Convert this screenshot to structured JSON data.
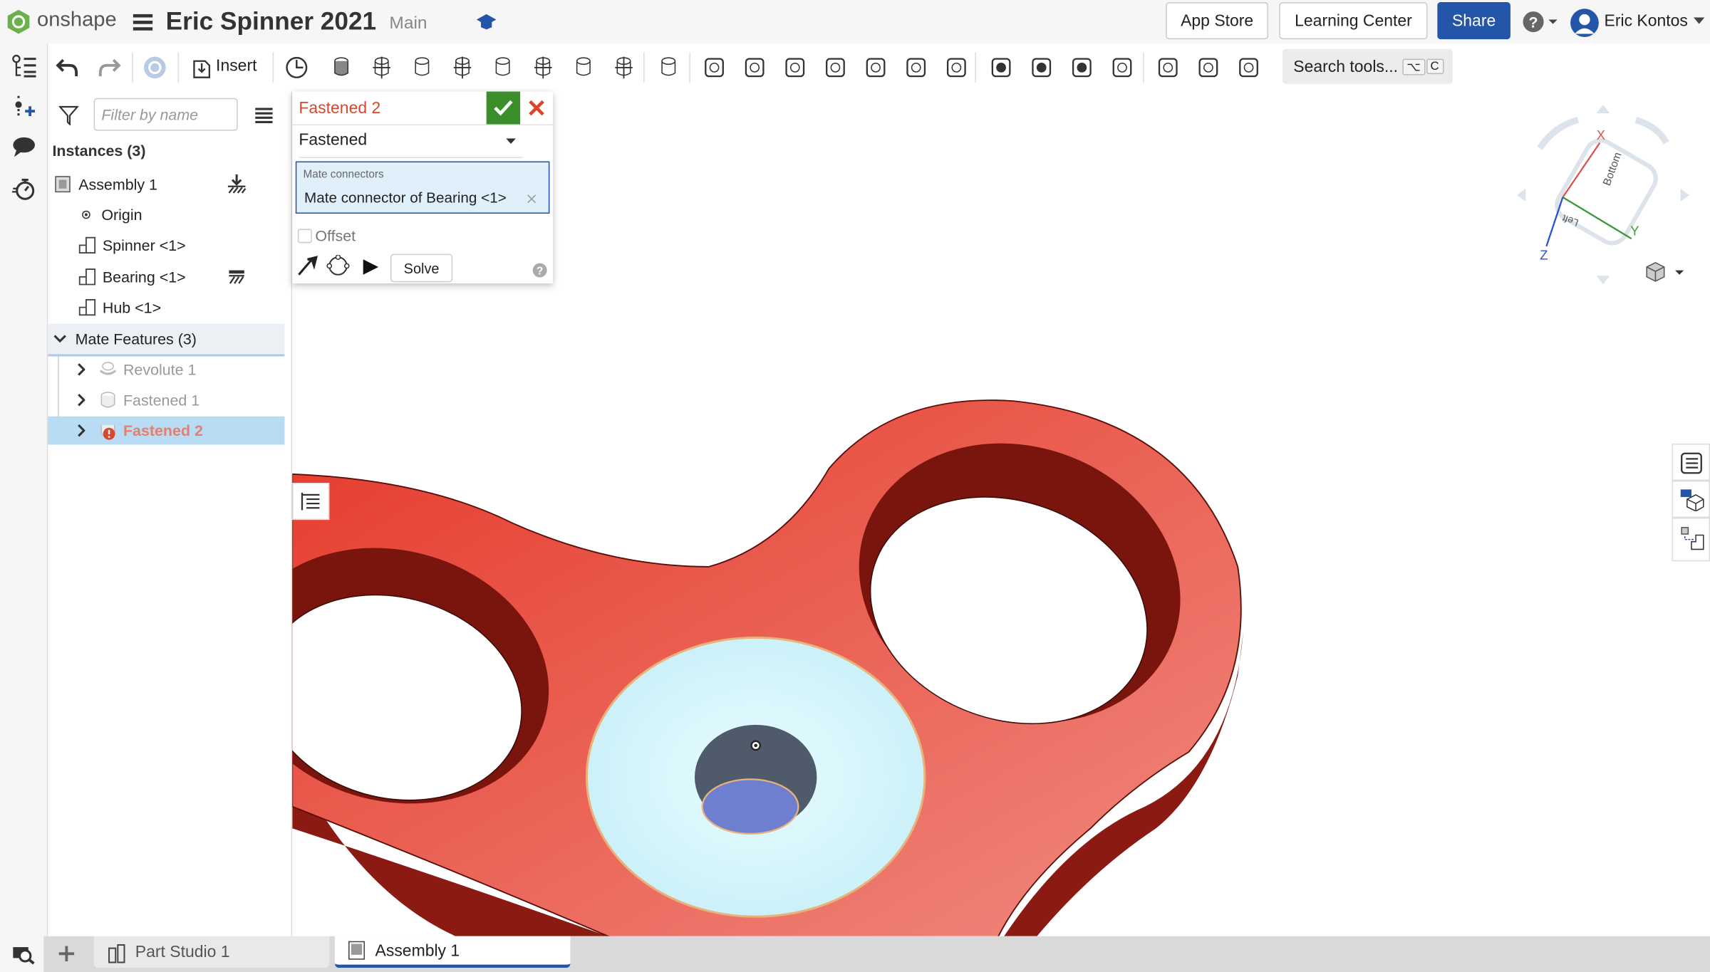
{
  "header": {
    "logo": "onshape",
    "document_title": "Eric Spinner 2021",
    "branch": "Main",
    "app_store": "App Store",
    "learning_center": "Learning Center",
    "share": "Share",
    "user_name": "Eric Kontos"
  },
  "toolbar": {
    "insert_label": "Insert",
    "search_placeholder": "Search tools...",
    "shortcut_keys": [
      "⌥",
      "C"
    ],
    "icons": [
      "timeline-icon",
      "fastened-mate-icon",
      "revolute-mate-icon",
      "slider-mate-icon",
      "planar-mate-icon",
      "cylindrical-mate-icon",
      "pin-slot-mate-icon",
      "ball-mate-icon",
      "parallel-mate-icon",
      "tangent-mate-icon",
      "group-icon",
      "mate-connector-icon",
      "mate-connector-select-icon",
      "relations-icon",
      "replicate-icon",
      "pattern-icon",
      "gear-relation-icon",
      "rack-pinion-icon",
      "screw-relation-icon",
      "linear-relation-icon",
      "limits-icon",
      "explode-icon",
      "bom-hide-icon",
      "insert-part-icon"
    ]
  },
  "instances": {
    "filter_placeholder": "Filter by name",
    "heading": "Instances (3)",
    "items": [
      "Assembly 1",
      "Origin",
      "Spinner <1>",
      "Bearing <1>",
      "Hub <1>"
    ]
  },
  "mate_features": {
    "heading": "Mate Features (3)",
    "items": [
      "Revolute 1",
      "Fastened 1",
      "Fastened 2"
    ]
  },
  "dialog": {
    "title": "Fastened 2",
    "mate_type": "Fastened",
    "connectors_label": "Mate connectors",
    "connector_value": "Mate connector of Bearing <1>",
    "offset_label": "Offset",
    "offset_checked": false,
    "solve_label": "Solve"
  },
  "viewcube": {
    "axes": [
      "X",
      "Y",
      "Z"
    ],
    "faces": [
      "Bottom",
      "Left"
    ]
  },
  "tabs": [
    "Part Studio 1",
    "Assembly 1"
  ],
  "colors": {
    "accent": "#2356a8",
    "error": "#d9462b",
    "confirm": "#3b8f2a",
    "part": "#e43a2a"
  }
}
